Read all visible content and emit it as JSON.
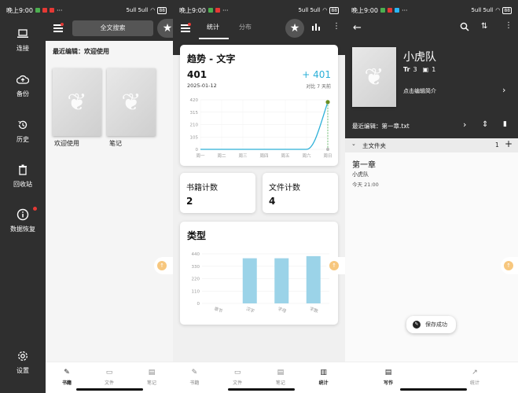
{
  "status_bar": {
    "time": "晚上9:00",
    "signal": "5ull 5ull",
    "battery": "88"
  },
  "panel1": {
    "sidebar": [
      {
        "label": "连接",
        "icon": "laptop-icon"
      },
      {
        "label": "备份",
        "icon": "cloud-upload-icon"
      },
      {
        "label": "历史",
        "icon": "history-icon"
      },
      {
        "label": "回收站",
        "icon": "trash-icon"
      },
      {
        "label": "数据恢复",
        "icon": "info-icon"
      },
      {
        "label": "设置",
        "icon": "gear-icon"
      }
    ],
    "search_label": "全文搜索",
    "recent_edit": "最近编辑：欢迎使用",
    "books": [
      {
        "title": "欢迎使用"
      },
      {
        "title": "笔记"
      }
    ],
    "nav": [
      {
        "label": "书籍",
        "active": true
      },
      {
        "label": "文件"
      },
      {
        "label": "笔记"
      }
    ]
  },
  "panel2": {
    "tabs": [
      {
        "label": "统计",
        "active": true
      },
      {
        "label": "分布"
      }
    ],
    "trend": {
      "title": "趋势 - 文字",
      "total": "401",
      "date": "2025-01-12",
      "delta": "+ 401",
      "delta_note": "对比 7 天前"
    },
    "book_count_label": "书籍计数",
    "book_count_value": "2",
    "file_count_label": "文件计数",
    "file_count_value": "4",
    "category_title": "类型",
    "nav": [
      {
        "label": "书籍"
      },
      {
        "label": "文件"
      },
      {
        "label": "笔记"
      },
      {
        "label": "统计",
        "active": true
      }
    ]
  },
  "panel3": {
    "book_title": "小虎队",
    "meta_count_a": "3",
    "meta_count_b": "1",
    "edit_intro": "点击编辑简介",
    "recent_edit": "最近编辑：第一章.txt",
    "folder_name": "主文件夹",
    "folder_count": "1",
    "chapter_title": "第一章",
    "chapter_sub": "小虎队",
    "chapter_time": "今天 21:00",
    "toast": "保存成功",
    "nav": [
      {
        "label": "写作",
        "active": true
      },
      {
        "label": "统计"
      }
    ]
  },
  "chart_data": [
    {
      "type": "line",
      "title": "趋势 - 文字",
      "x": [
        "周一",
        "周二",
        "周三",
        "周四",
        "周五",
        "周六",
        "周日"
      ],
      "series": [
        {
          "values": [
            0,
            0,
            0,
            0,
            0,
            0,
            401
          ]
        }
      ],
      "yticks": [
        0,
        105,
        210,
        315,
        420
      ],
      "ylim": [
        0,
        420
      ],
      "color": "#2cb0d8",
      "grid": true
    },
    {
      "type": "bar",
      "title": "类型",
      "categories": [
        "章节",
        "汉字",
        "字母",
        "字数"
      ],
      "values": [
        0,
        401,
        401,
        420
      ],
      "yticks": [
        0,
        110,
        220,
        330,
        440
      ],
      "ylim": [
        0,
        440
      ],
      "color": "#9bd3e8",
      "grid": true
    }
  ]
}
